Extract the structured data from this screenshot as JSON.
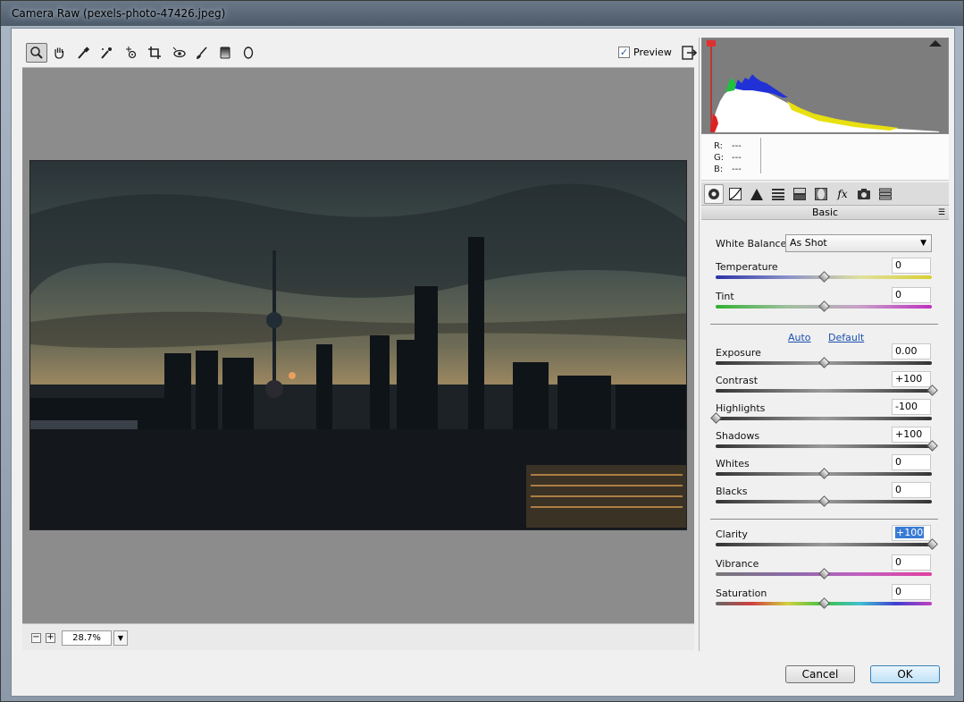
{
  "window": {
    "title": "Camera Raw (pexels-photo-47426.jpeg)"
  },
  "toolbar": {
    "preview_label": "Preview",
    "preview_checked": "✓"
  },
  "tools": [
    "zoom-tool",
    "hand-tool",
    "white-balance-tool",
    "color-sampler-tool",
    "targeted-adjustment-tool",
    "crop-tool",
    "red-eye-tool",
    "adjustment-brush-tool",
    "graduated-filter-tool",
    "radial-filter-tool"
  ],
  "zoom": {
    "value": "28.7%",
    "minus": "−",
    "plus": "+"
  },
  "histogram": {
    "r_label": "R:",
    "g_label": "G:",
    "b_label": "B:",
    "r_value": "---",
    "g_value": "---",
    "b_value": "---"
  },
  "panel": {
    "title": "Basic",
    "menu": "☰"
  },
  "basic": {
    "white_balance": {
      "label": "White Balance:",
      "value": "As Shot"
    },
    "auto": "Auto",
    "default": "Default",
    "sliders": [
      {
        "id": "temperature",
        "label": "Temperature",
        "value": "0",
        "pos": 0.5
      },
      {
        "id": "tint",
        "label": "Tint",
        "value": "0",
        "pos": 0.5
      },
      {
        "id": "exposure",
        "label": "Exposure",
        "value": "0.00",
        "pos": 0.5
      },
      {
        "id": "contrast",
        "label": "Contrast",
        "value": "+100",
        "pos": 1.0
      },
      {
        "id": "highlights",
        "label": "Highlights",
        "value": "-100",
        "pos": 0.0
      },
      {
        "id": "shadows",
        "label": "Shadows",
        "value": "+100",
        "pos": 1.0
      },
      {
        "id": "whites",
        "label": "Whites",
        "value": "0",
        "pos": 0.5
      },
      {
        "id": "blacks",
        "label": "Blacks",
        "value": "0",
        "pos": 0.5
      },
      {
        "id": "clarity",
        "label": "Clarity",
        "value": "+100",
        "pos": 1.0
      },
      {
        "id": "vibrance",
        "label": "Vibrance",
        "value": "0",
        "pos": 0.5
      },
      {
        "id": "saturation",
        "label": "Saturation",
        "value": "0",
        "pos": 0.5
      }
    ]
  },
  "buttons": {
    "cancel": "Cancel",
    "ok": "OK"
  }
}
